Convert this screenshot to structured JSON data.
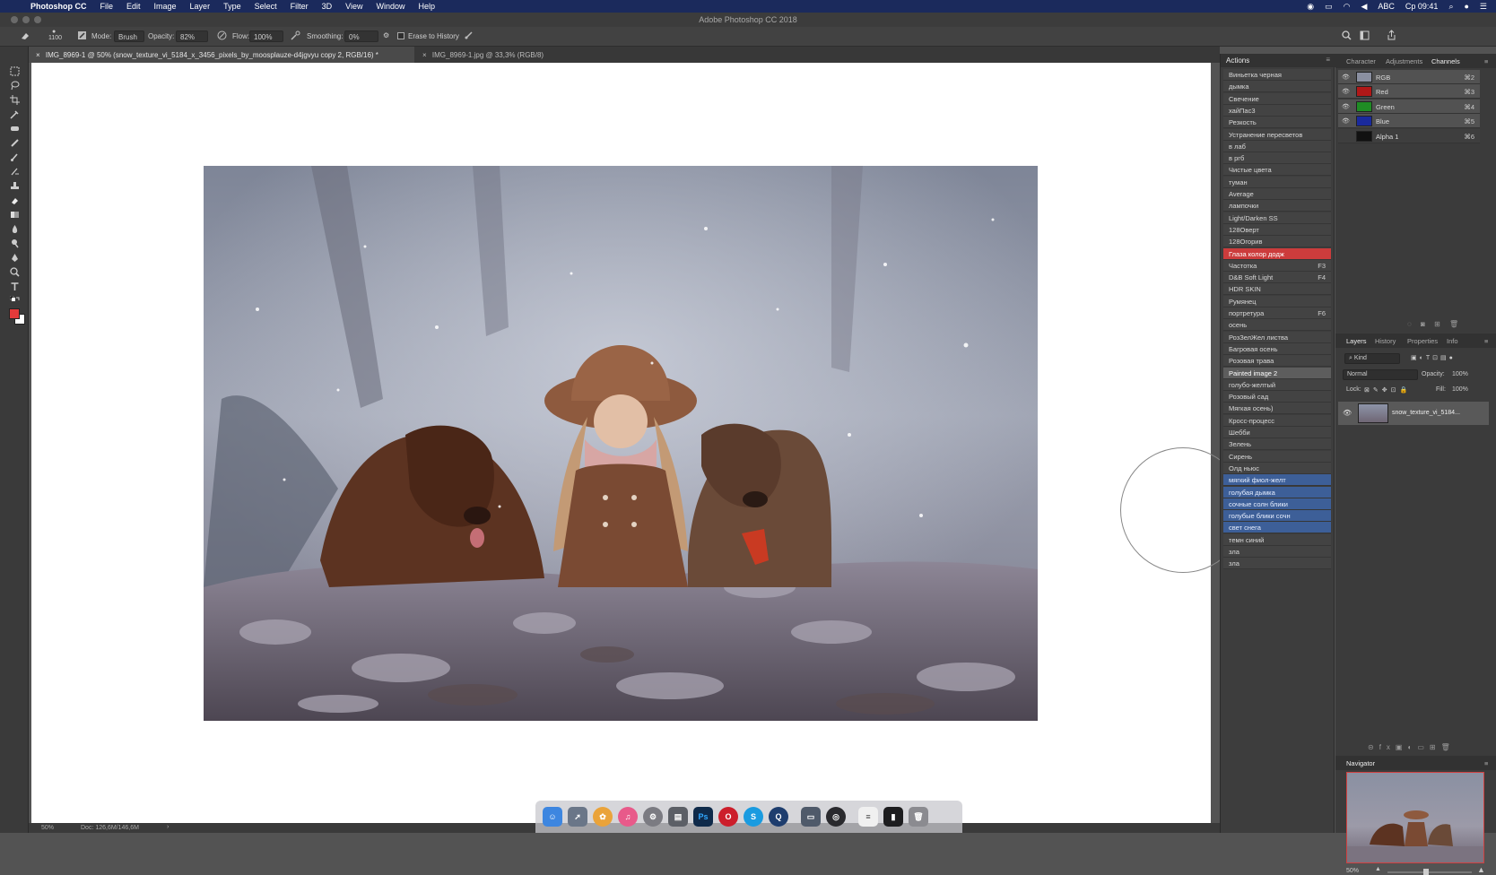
{
  "menubar": {
    "app": "Photoshop CC",
    "items": [
      "File",
      "Edit",
      "Image",
      "Layer",
      "Type",
      "Select",
      "Filter",
      "3D",
      "View",
      "Window",
      "Help"
    ],
    "input_source": "ABC",
    "clock": "Ср 09:41"
  },
  "window": {
    "title": "Adobe Photoshop CC 2018"
  },
  "options": {
    "brush_size": "1100",
    "mode_label": "Mode:",
    "mode_value": "Brush",
    "opacity_label": "Opacity:",
    "opacity_value": "82%",
    "flow_label": "Flow:",
    "flow_value": "100%",
    "smoothing_label": "Smoothing:",
    "smoothing_value": "0%",
    "erase_history": "Erase to History"
  },
  "tabs": [
    {
      "label": "IMG_8969-1 @ 50% (snow_texture_vi_5184_x_3456_pixels_by_moosplauze-d4jgvyu copy 2, RGB/16) *"
    },
    {
      "label": "IMG_8969-1.jpg @ 33,3% (RGB/8)"
    }
  ],
  "status": {
    "zoom": "50%",
    "doc": "Doc: 126,6M/146,6M"
  },
  "actions": {
    "title": "Actions",
    "items": [
      {
        "label": "Виньетка черная",
        "key": "",
        "state": ""
      },
      {
        "label": "дымка",
        "key": "",
        "state": ""
      },
      {
        "label": "Свечение",
        "key": "",
        "state": ""
      },
      {
        "label": "хайПас3",
        "key": "",
        "state": ""
      },
      {
        "label": "Резкость",
        "key": "",
        "state": ""
      },
      {
        "label": "Устранение пересветов",
        "key": "",
        "state": ""
      },
      {
        "label": "в лаб",
        "key": "",
        "state": ""
      },
      {
        "label": "в ргб",
        "key": "",
        "state": ""
      },
      {
        "label": "Чистые цвета",
        "key": "",
        "state": ""
      },
      {
        "label": "туман",
        "key": "",
        "state": ""
      },
      {
        "label": "Average",
        "key": "",
        "state": ""
      },
      {
        "label": "лампочки",
        "key": "",
        "state": ""
      },
      {
        "label": "Light/Darken SS",
        "key": "",
        "state": ""
      },
      {
        "label": "128Оверт",
        "key": "",
        "state": ""
      },
      {
        "label": "128Огорив",
        "key": "",
        "state": ""
      },
      {
        "label": "Глаза колор додж",
        "key": "",
        "state": "red"
      },
      {
        "label": "Частотка",
        "key": "F3",
        "state": ""
      },
      {
        "label": "D&B Soft Light",
        "key": "F4",
        "state": ""
      },
      {
        "label": "HDR SKIN",
        "key": "",
        "state": ""
      },
      {
        "label": "Румянец",
        "key": "",
        "state": ""
      },
      {
        "label": "портретура",
        "key": "F6",
        "state": ""
      },
      {
        "label": "осень",
        "key": "",
        "state": ""
      },
      {
        "label": "РозЗелЖел листва",
        "key": "",
        "state": ""
      },
      {
        "label": "Багровая осень",
        "key": "",
        "state": ""
      },
      {
        "label": "Розовая трава",
        "key": "",
        "state": ""
      },
      {
        "label": "Painted image 2",
        "key": "",
        "state": "gray"
      },
      {
        "label": "голубо-желтый",
        "key": "",
        "state": ""
      },
      {
        "label": "Розовый сад",
        "key": "",
        "state": ""
      },
      {
        "label": "Мягкая осень)",
        "key": "",
        "state": ""
      },
      {
        "label": "Кросс-процесс",
        "key": "",
        "state": ""
      },
      {
        "label": "Шебби",
        "key": "",
        "state": ""
      },
      {
        "label": "Зелень",
        "key": "",
        "state": ""
      },
      {
        "label": "Сирень",
        "key": "",
        "state": ""
      },
      {
        "label": "Олд ньюс",
        "key": "",
        "state": ""
      },
      {
        "label": "мягкий фиол-желт",
        "key": "",
        "state": "blue"
      },
      {
        "label": "голубая дымка",
        "key": "",
        "state": "blue"
      },
      {
        "label": "сочные солн блики",
        "key": "",
        "state": "blue"
      },
      {
        "label": "голубые блики сочн",
        "key": "",
        "state": "blue"
      },
      {
        "label": "свет снега",
        "key": "",
        "state": "blue"
      },
      {
        "label": "темн синий",
        "key": "",
        "state": ""
      },
      {
        "label": "зла",
        "key": "",
        "state": ""
      },
      {
        "label": "зла",
        "key": "",
        "state": ""
      }
    ]
  },
  "channels_panel": {
    "tabs": [
      "Character",
      "Adjustments",
      "Channels"
    ],
    "channels": [
      {
        "name": "RGB",
        "shortcut": "⌘2",
        "color": "#8a8fa0"
      },
      {
        "name": "Red",
        "shortcut": "⌘3",
        "color": "#b01818"
      },
      {
        "name": "Green",
        "shortcut": "⌘4",
        "color": "#1f8c24"
      },
      {
        "name": "Blue",
        "shortcut": "⌘5",
        "color": "#1a2a9c"
      },
      {
        "name": "Alpha 1",
        "shortcut": "⌘6",
        "color": "#111111"
      }
    ]
  },
  "layers_panel": {
    "tabs": [
      "Layers",
      "History",
      "Properties",
      "Info"
    ],
    "kind": "Kind",
    "blend": "Normal",
    "opacity_label": "Opacity:",
    "opacity": "100%",
    "lock_label": "Lock:",
    "fill_label": "Fill:",
    "fill": "100%",
    "layer_name": "snow_texture_vi_5184..."
  },
  "navigator": {
    "title": "Navigator",
    "zoom": "50%"
  },
  "colors": {
    "accent_red": "#cc3c3c",
    "accent_blue": "#3d5f98",
    "menubar": "#1b2a5c"
  }
}
